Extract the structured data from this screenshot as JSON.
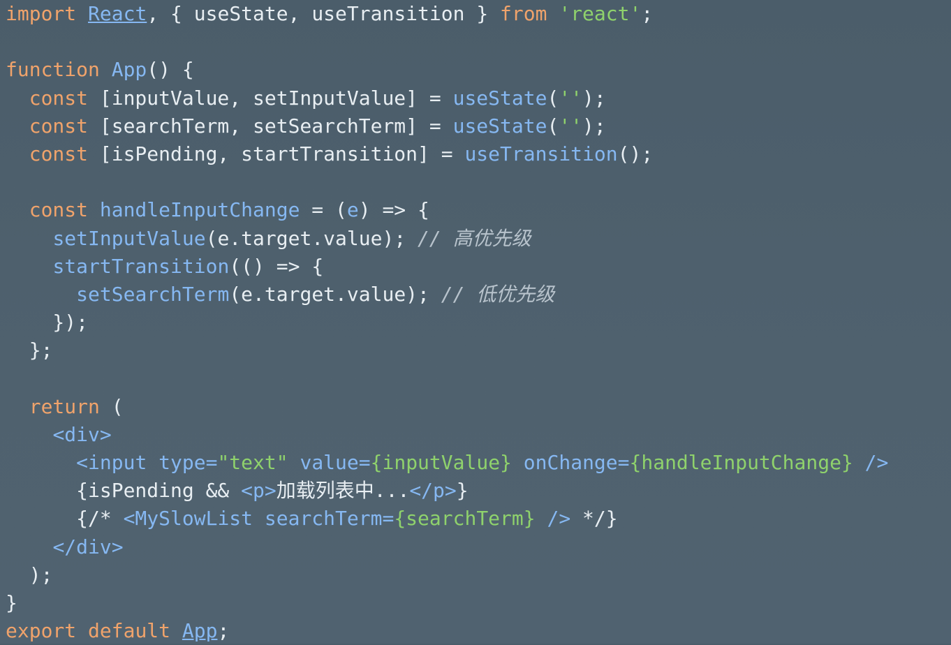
{
  "code_lines": [
    {
      "segments": [
        {
          "t": "import ",
          "c": "kw"
        },
        {
          "t": "React",
          "c": "react"
        },
        {
          "t": ", { useState, useTransition } ",
          "c": "plain"
        },
        {
          "t": "from ",
          "c": "kw"
        },
        {
          "t": "'react'",
          "c": "str"
        },
        {
          "t": ";",
          "c": "plain"
        }
      ]
    },
    {
      "segments": [
        {
          "t": "",
          "c": "plain"
        }
      ]
    },
    {
      "segments": [
        {
          "t": "function ",
          "c": "kw"
        },
        {
          "t": "App",
          "c": "fn"
        },
        {
          "t": "() {",
          "c": "plain"
        }
      ]
    },
    {
      "segments": [
        {
          "t": "  const ",
          "c": "kw"
        },
        {
          "t": "[inputValue, setInputValue] = ",
          "c": "plain"
        },
        {
          "t": "useState",
          "c": "fn"
        },
        {
          "t": "(",
          "c": "plain"
        },
        {
          "t": "''",
          "c": "str"
        },
        {
          "t": ");",
          "c": "plain"
        }
      ]
    },
    {
      "segments": [
        {
          "t": "  const ",
          "c": "kw"
        },
        {
          "t": "[searchTerm, setSearchTerm] = ",
          "c": "plain"
        },
        {
          "t": "useState",
          "c": "fn"
        },
        {
          "t": "(",
          "c": "plain"
        },
        {
          "t": "''",
          "c": "str"
        },
        {
          "t": ");",
          "c": "plain"
        }
      ]
    },
    {
      "segments": [
        {
          "t": "  const ",
          "c": "kw"
        },
        {
          "t": "[isPending, startTransition] = ",
          "c": "plain"
        },
        {
          "t": "useTransition",
          "c": "fn"
        },
        {
          "t": "();",
          "c": "plain"
        }
      ]
    },
    {
      "segments": [
        {
          "t": "",
          "c": "plain"
        }
      ]
    },
    {
      "segments": [
        {
          "t": "  const ",
          "c": "kw"
        },
        {
          "t": "handleInputChange",
          "c": "fn"
        },
        {
          "t": " = (",
          "c": "plain"
        },
        {
          "t": "e",
          "c": "param"
        },
        {
          "t": ") => {",
          "c": "plain"
        }
      ]
    },
    {
      "segments": [
        {
          "t": "    ",
          "c": "plain"
        },
        {
          "t": "setInputValue",
          "c": "fn"
        },
        {
          "t": "(e.target.value); ",
          "c": "plain"
        },
        {
          "t": "// 高优先级",
          "c": "cm"
        }
      ]
    },
    {
      "segments": [
        {
          "t": "    ",
          "c": "plain"
        },
        {
          "t": "startTransition",
          "c": "fn"
        },
        {
          "t": "(() => {",
          "c": "plain"
        }
      ]
    },
    {
      "segments": [
        {
          "t": "      ",
          "c": "plain"
        },
        {
          "t": "setSearchTerm",
          "c": "fn"
        },
        {
          "t": "(e.target.value); ",
          "c": "plain"
        },
        {
          "t": "// 低优先级",
          "c": "cm"
        }
      ]
    },
    {
      "segments": [
        {
          "t": "    });",
          "c": "plain"
        }
      ]
    },
    {
      "segments": [
        {
          "t": "  };",
          "c": "plain"
        }
      ]
    },
    {
      "segments": [
        {
          "t": "",
          "c": "plain"
        }
      ]
    },
    {
      "segments": [
        {
          "t": "  return ",
          "c": "kw"
        },
        {
          "t": "(",
          "c": "plain"
        }
      ]
    },
    {
      "segments": [
        {
          "t": "    ",
          "c": "plain"
        },
        {
          "t": "<div>",
          "c": "tag"
        }
      ]
    },
    {
      "segments": [
        {
          "t": "      ",
          "c": "plain"
        },
        {
          "t": "<input type=",
          "c": "tag"
        },
        {
          "t": "\"text\"",
          "c": "str"
        },
        {
          "t": " value=",
          "c": "tag"
        },
        {
          "t": "{inputValue}",
          "c": "obj"
        },
        {
          "t": " onChange=",
          "c": "tag"
        },
        {
          "t": "{handleInputChange}",
          "c": "obj"
        },
        {
          "t": " />",
          "c": "tag"
        }
      ]
    },
    {
      "segments": [
        {
          "t": "      {isPending && ",
          "c": "plain"
        },
        {
          "t": "<p>",
          "c": "tag"
        },
        {
          "t": "加载列表中...",
          "c": "plain"
        },
        {
          "t": "</p>",
          "c": "tag"
        },
        {
          "t": "}",
          "c": "plain"
        }
      ]
    },
    {
      "segments": [
        {
          "t": "      {/* ",
          "c": "plain"
        },
        {
          "t": "<MySlowList searchTerm=",
          "c": "tag"
        },
        {
          "t": "{searchTerm}",
          "c": "obj"
        },
        {
          "t": " />",
          "c": "tag"
        },
        {
          "t": " */}",
          "c": "plain"
        }
      ]
    },
    {
      "segments": [
        {
          "t": "    ",
          "c": "plain"
        },
        {
          "t": "</div>",
          "c": "tag"
        }
      ]
    },
    {
      "segments": [
        {
          "t": "  );",
          "c": "plain"
        }
      ]
    },
    {
      "segments": [
        {
          "t": "}",
          "c": "plain"
        }
      ]
    },
    {
      "segments": [
        {
          "t": "export ",
          "c": "kw"
        },
        {
          "t": "default ",
          "c": "kw"
        },
        {
          "t": "App",
          "c": "app-ref"
        },
        {
          "t": ";",
          "c": "plain"
        }
      ]
    }
  ]
}
